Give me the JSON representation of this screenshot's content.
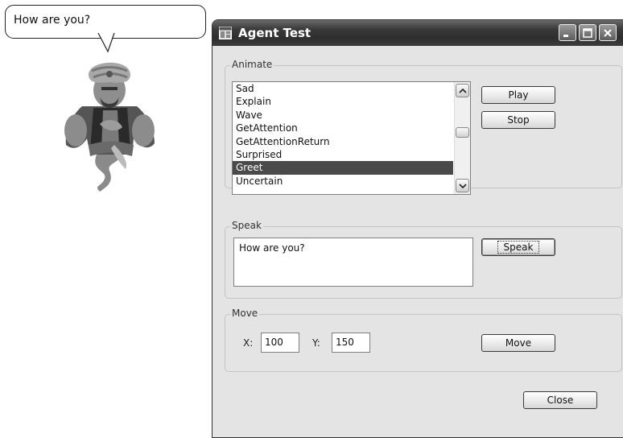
{
  "balloon": {
    "text": "How are you?"
  },
  "window": {
    "title": "Agent Test",
    "icon": "window-app-icon",
    "controls": [
      "minimize-icon",
      "maximize-icon",
      "close-icon"
    ]
  },
  "animate": {
    "label": "Animate",
    "items": [
      "Sad",
      "Explain",
      "Wave",
      "GetAttention",
      "GetAttentionReturn",
      "Surprised",
      "Greet",
      "Uncertain"
    ],
    "selected": "Greet",
    "play_label": "Play",
    "stop_label": "Stop"
  },
  "speak": {
    "label": "Speak",
    "text": "How are you?",
    "button_label": "Speak"
  },
  "move": {
    "label": "Move",
    "x_label": "X:",
    "x_value": "100",
    "y_label": "Y:",
    "y_value": "150",
    "button_label": "Move"
  },
  "close_label": "Close",
  "colors": {
    "titlebar": "#3a3a3a",
    "selection": "#4a4a4a",
    "window_bg": "#e4e4e4"
  }
}
